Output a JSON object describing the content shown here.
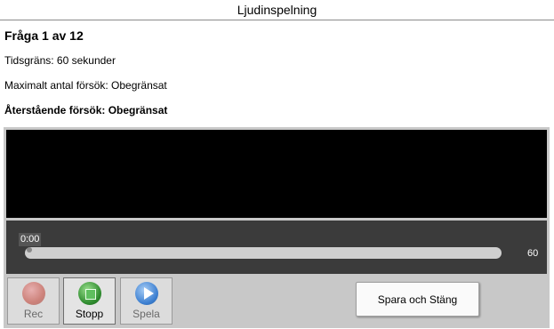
{
  "window": {
    "title": "Ljudinspelning"
  },
  "question": {
    "title": "Fråga 1 av 12",
    "time_limit": "Tidsgräns: 60 sekunder",
    "max_attempts": "Maximalt antal försök: Obegränsat",
    "remaining_attempts": "Återstående försök: Obegränsat"
  },
  "player": {
    "current_time": "0:00",
    "total_time": "60",
    "progress_fraction": 0.0
  },
  "controls": {
    "rec_label": "Rec",
    "stop_label": "Stopp",
    "play_label": "Spela",
    "save_close_label": "Spara och Stäng"
  },
  "icons": {
    "rec": "record-icon",
    "stop": "stop-icon",
    "play": "play-icon"
  },
  "colors": {
    "video_bg": "#000000",
    "timeline_bg": "#3b3b3b",
    "panel_bg": "#c8c8c8"
  }
}
